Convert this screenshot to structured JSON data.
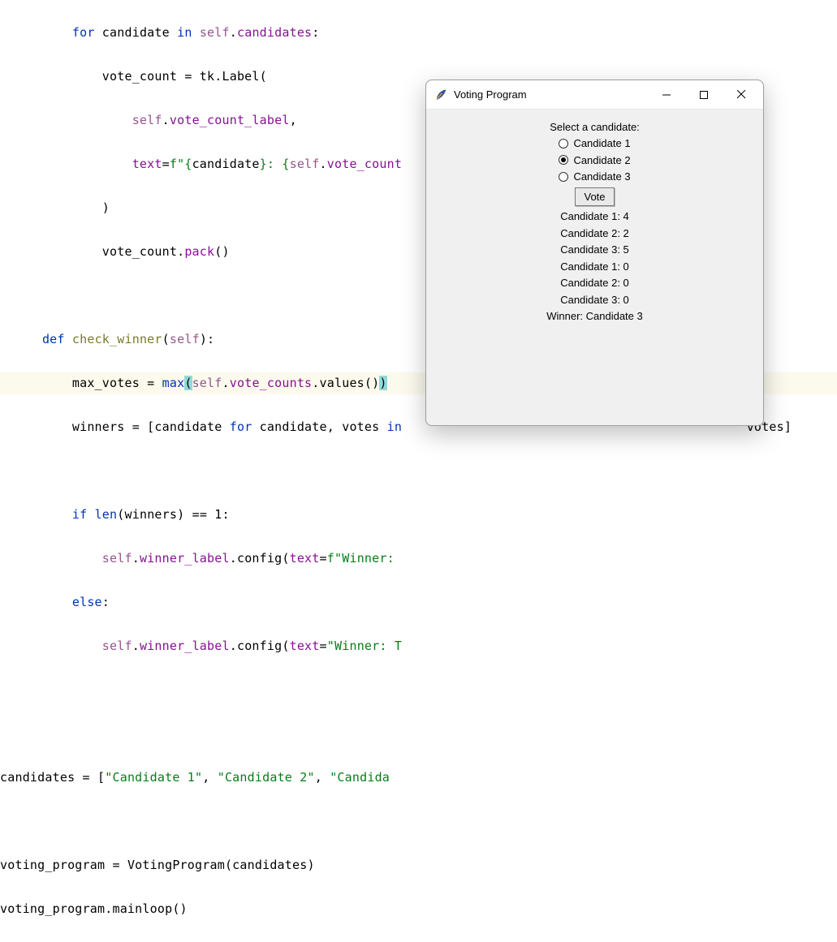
{
  "code": {
    "line1": {
      "kw": "for",
      "id1": "candidate",
      "kw2": "in",
      "self": "self",
      "attr": "candidates"
    },
    "line2": {
      "id": "vote_count",
      "op": "= tk.",
      "cls": "Label",
      "paren": "("
    },
    "line3": {
      "self": "self",
      "attr": "vote_count_label",
      "comma": ","
    },
    "line4": {
      "attr": "text",
      "op": "=",
      "fprefix": "f\"",
      "str1": "{",
      "id": "candidate",
      "str2": "}",
      "colon": ": ",
      "str3": "{",
      "self": "self",
      "attr2": "vote_count"
    },
    "line5": {
      "paren": ")"
    },
    "line6": {
      "id": "vote_count",
      "attr": "pack",
      "paren": "()"
    },
    "line8": {
      "kw": "def",
      "fn": "check_winner",
      "paren": "(",
      "self": "self",
      "close": "):"
    },
    "line9": {
      "id": "max_votes",
      "op": " = ",
      "builtin": "max",
      "p1": "(",
      "self": "self",
      "attr": "vote_counts",
      "method": "values",
      "p2": "()",
      "p3": ")"
    },
    "line10": {
      "id": "winners",
      "op": " = [",
      "id2": "candidate",
      "kw": "for",
      "id3": "candidate",
      "comma": ", ",
      "id4": "votes",
      "kw2": "in",
      "tail": "votes]"
    },
    "line12": {
      "kw": "if",
      "builtin": "len",
      "p": "(",
      "id": "winners",
      "p2": ") == ",
      "num": "1",
      "colon": ":"
    },
    "line13": {
      "self": "self",
      "attr": "winner_label",
      "method": "config",
      "p": "(",
      "kwarg": "text",
      "op": "=",
      "fprefix": "f\"",
      "str": "Winner: "
    },
    "line14": {
      "kw": "else",
      ":": ":"
    },
    "line15": {
      "self": "self",
      "attr": "winner_label",
      "method": "config",
      "p": "(",
      "kwarg": "text",
      "op": "=",
      "str": "\"Winner: T"
    },
    "line17": {
      "id": "candidates",
      "op": " = [",
      "s1": "\"Candidate 1\"",
      "c": ", ",
      "s2": "\"Candidate 2\"",
      "c2": ", ",
      "s3": "\"Candida"
    },
    "line19": {
      "id": "voting_program",
      "op": " = ",
      "cls": "VotingProgram",
      "p": "(",
      "arg": "candidates",
      "p2": ")"
    },
    "line20": {
      "id": "voting_program",
      "dot": ".",
      "method": "mainloop",
      "p": "()"
    }
  },
  "tk": {
    "title": "Voting Program",
    "prompt": "Select a candidate:",
    "radios": [
      {
        "label": "Candidate 1",
        "selected": false
      },
      {
        "label": "Candidate 2",
        "selected": true
      },
      {
        "label": "Candidate 3",
        "selected": false
      }
    ],
    "vote_button": "Vote",
    "counts": [
      "Candidate 1: 4",
      "Candidate 2: 2",
      "Candidate 3: 5",
      "Candidate 1: 0",
      "Candidate 2: 0",
      "Candidate 3: 0"
    ],
    "winner": "Winner: Candidate 3"
  }
}
